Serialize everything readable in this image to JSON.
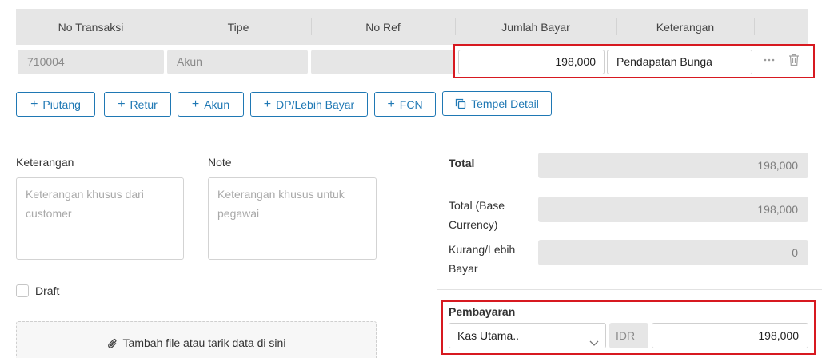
{
  "table": {
    "headers": [
      "No Transaksi",
      "Tipe",
      "No Ref",
      "Jumlah Bayar",
      "Keterangan"
    ],
    "row": {
      "no_transaksi": "710004",
      "tipe": "Akun",
      "no_ref": "",
      "jumlah_bayar": "198,000",
      "keterangan": "Pendapatan Bunga"
    }
  },
  "buttons": {
    "piutang": "Piutang",
    "retur": "Retur",
    "akun": "Akun",
    "dp": "DP/Lebih Bayar",
    "fcn": "FCN",
    "tempel": "Tempel Detail"
  },
  "form": {
    "keterangan_label": "Keterangan",
    "keterangan_placeholder": "Keterangan khusus dari customer",
    "note_label": "Note",
    "note_placeholder": "Keterangan khusus untuk pegawai",
    "draft_label": "Draft",
    "dropzone_text": "Tambah file atau tarik data di sini"
  },
  "totals": {
    "total_label": "Total",
    "total_value": "198,000",
    "base_label": "Total (Base Currency)",
    "base_value": "198,000",
    "kurang_label": "Kurang/Lebih Bayar",
    "kurang_value": "0"
  },
  "pembayaran": {
    "label": "Pembayaran",
    "account": "Kas Utama..",
    "currency": "IDR",
    "amount": "198,000"
  },
  "colors": {
    "accent": "#1f78b4",
    "highlight": "#d71920"
  },
  "icons": [
    "plus-icon",
    "copy-icon",
    "more-icon",
    "trash-icon",
    "chevron-down-icon",
    "paperclip-icon"
  ]
}
